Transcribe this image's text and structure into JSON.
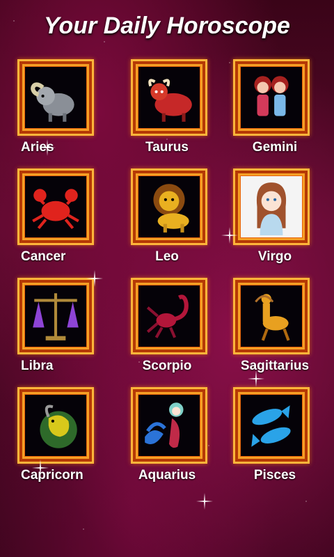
{
  "header": {
    "title": "Your Daily Horoscope"
  },
  "signs": [
    {
      "label": "Aries",
      "icon": "ram-icon",
      "color": "#8a8f97"
    },
    {
      "label": "Taurus",
      "icon": "bull-icon",
      "color": "#c62828"
    },
    {
      "label": "Gemini",
      "icon": "twins-icon",
      "color": "#d33a5a"
    },
    {
      "label": "Cancer",
      "icon": "crab-icon",
      "color": "#e0231d"
    },
    {
      "label": "Leo",
      "icon": "lion-icon",
      "color": "#e9b020"
    },
    {
      "label": "Virgo",
      "icon": "maiden-icon",
      "color": "#b8d9ee"
    },
    {
      "label": "Libra",
      "icon": "scales-icon",
      "color": "#8e44d6"
    },
    {
      "label": "Scorpio",
      "icon": "scorpion-icon",
      "color": "#b3163a"
    },
    {
      "label": "Sagittarius",
      "icon": "archer-icon",
      "color": "#e8a020"
    },
    {
      "label": "Capricorn",
      "icon": "goat-icon",
      "color": "#d8c81b"
    },
    {
      "label": "Aquarius",
      "icon": "water-bearer-icon",
      "color": "#2b73d8"
    },
    {
      "label": "Pisces",
      "icon": "fish-icon",
      "color": "#2aa3e8"
    }
  ]
}
